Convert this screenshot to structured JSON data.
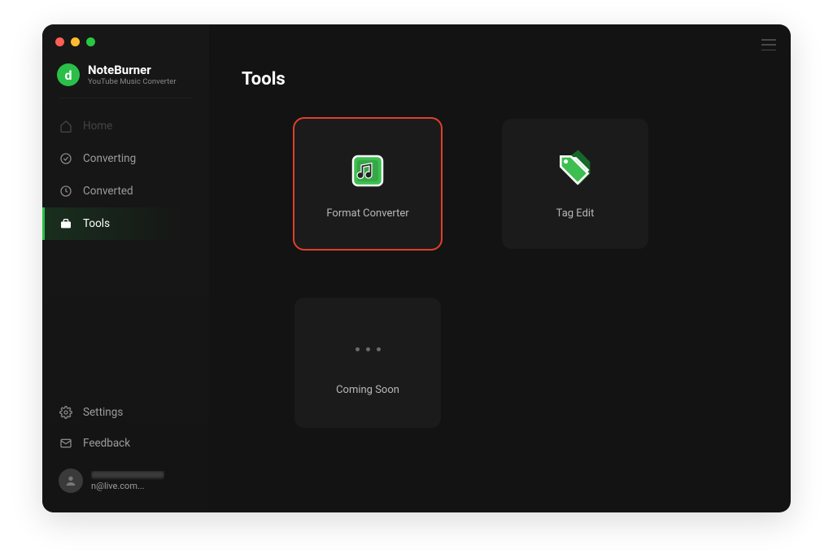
{
  "app": {
    "name": "NoteBurner",
    "subtitle": "YouTube Music Converter",
    "logo_letter": "d"
  },
  "sidebar": {
    "items": [
      {
        "label": "Home"
      },
      {
        "label": "Converting"
      },
      {
        "label": "Converted"
      },
      {
        "label": "Tools"
      }
    ],
    "bottom": [
      {
        "label": "Settings"
      },
      {
        "label": "Feedback"
      }
    ]
  },
  "user": {
    "email_truncated": "n@live.com..."
  },
  "page": {
    "title": "Tools"
  },
  "tools": [
    {
      "label": "Format Converter"
    },
    {
      "label": "Tag Edit"
    },
    {
      "label": "Coming Soon"
    }
  ],
  "colors": {
    "accent": "#2bbf4a",
    "highlight": "#e0402a",
    "bg": "#131313",
    "card": "#1b1b1b"
  }
}
